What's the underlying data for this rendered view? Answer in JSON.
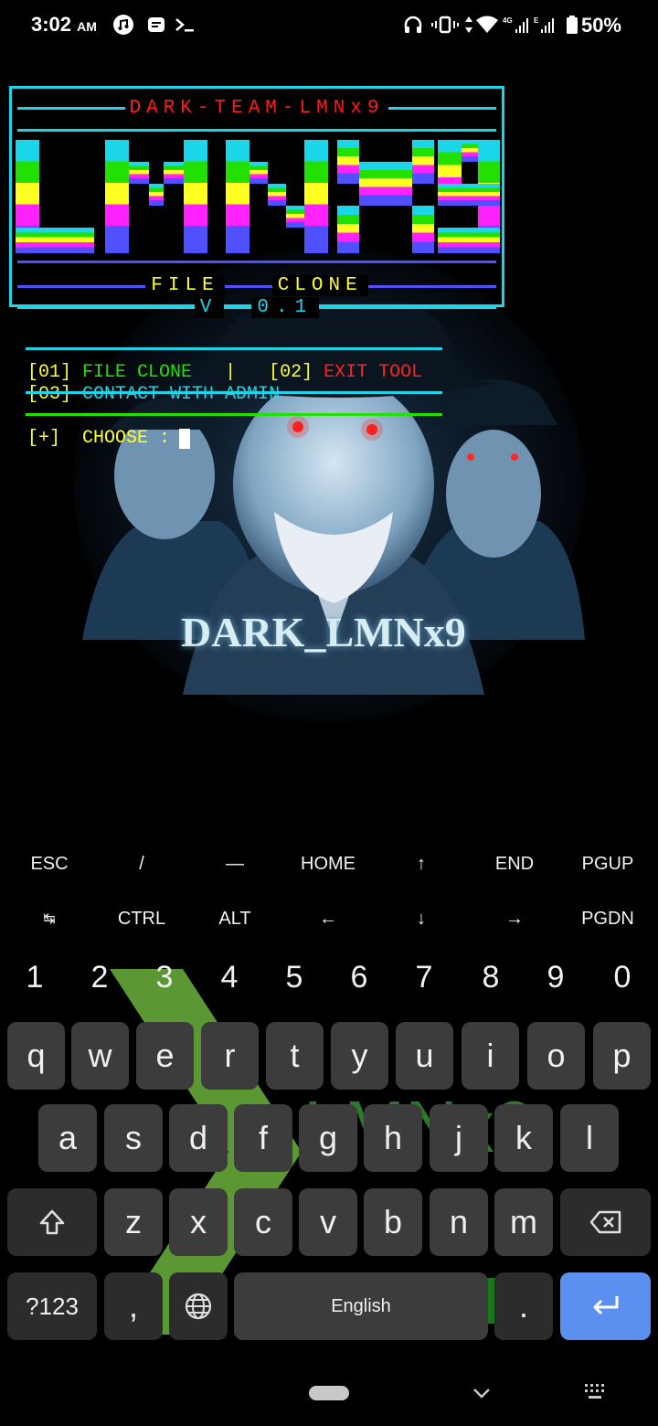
{
  "status_bar": {
    "time": "3:02",
    "ampm": "AM",
    "battery": "50%",
    "icons": [
      "music-icon",
      "notes-icon",
      "terminal-icon",
      "headphones-icon",
      "vibrate-icon",
      "data-arrows-icon",
      "wifi-icon",
      "signal-4g-icon",
      "signal-e-icon",
      "battery-icon"
    ]
  },
  "banner": {
    "title": "DARK-TEAM-LMNx9",
    "logo": "LMNX9",
    "subtitle_left": "FILE",
    "subtitle_right": "CLONE",
    "version_v": "V",
    "version_num": "0.1",
    "colors": [
      "#1ad6e8",
      "#22e000",
      "#ffff22",
      "#ff22ff",
      "#5050ff"
    ]
  },
  "art": {
    "caption": "DARK_LMNx9"
  },
  "menu": {
    "opt1_num": "[01]",
    "opt1_label": "FILE CLONE",
    "sep": "|",
    "opt2_num": "[02]",
    "opt2_label": "EXIT TOOL",
    "opt3_num": "[03]",
    "opt3_label": "CONTACT WITH ADMIN",
    "prompt_prefix": "[+]",
    "prompt_label": "CHOOSE :"
  },
  "extra_keys": {
    "row1": [
      "ESC",
      "/",
      "—",
      "HOME",
      "↑",
      "END",
      "PGUP"
    ],
    "row2": [
      "↹",
      "CTRL",
      "ALT",
      "←",
      "↓",
      "→",
      "PGDN"
    ]
  },
  "keyboard": {
    "numbers": [
      "1",
      "2",
      "3",
      "4",
      "5",
      "6",
      "7",
      "8",
      "9",
      "0"
    ],
    "row1": [
      "q",
      "w",
      "e",
      "r",
      "t",
      "y",
      "u",
      "i",
      "o",
      "p"
    ],
    "row2": [
      "a",
      "s",
      "d",
      "f",
      "g",
      "h",
      "j",
      "k",
      "l"
    ],
    "row3": [
      "z",
      "x",
      "c",
      "v",
      "b",
      "n",
      "m"
    ],
    "symbols": "?123",
    "comma": ",",
    "space": "English",
    "period": ".",
    "watermark": "LMNx9"
  }
}
